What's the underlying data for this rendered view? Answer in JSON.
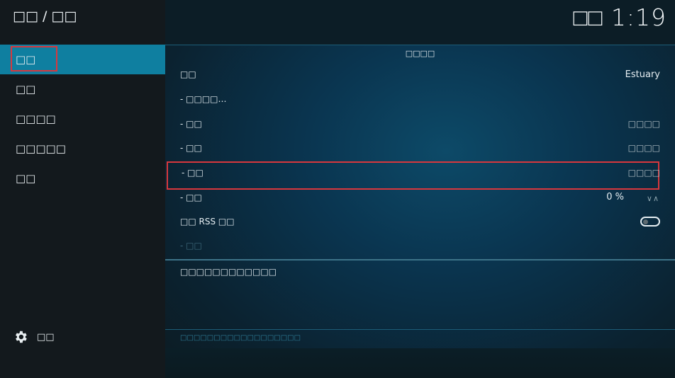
{
  "breadcrumb": "□□ / □□",
  "clock": "□□ 1:19",
  "sidebar": {
    "items": [
      {
        "label": "□□",
        "active": true
      },
      {
        "label": "□□"
      },
      {
        "label": "□□□□"
      },
      {
        "label": "□□□□□"
      },
      {
        "label": "□□"
      }
    ],
    "settings_label": "□□"
  },
  "main": {
    "section_title": "□□□□",
    "rows": [
      {
        "label": "□□",
        "value": "Estuary"
      },
      {
        "label": "- □□□□…",
        "value": ""
      },
      {
        "label": "- □□",
        "value": "□□□□"
      },
      {
        "label": "- □□",
        "value": "□□□□"
      },
      {
        "label": "- □□",
        "value": "□□□□"
      },
      {
        "label": "- □□",
        "value": "0 %"
      },
      {
        "label": "□□ RSS □□",
        "value": ""
      },
      {
        "label": "- □□",
        "value": ""
      }
    ],
    "description": "□□□□□□□□□□□□",
    "footer_hint": "□□□□□□□□□□□□□□□□□□"
  },
  "colors": {
    "accent": "#0f7fa0",
    "focus_border": "#d8373d"
  }
}
